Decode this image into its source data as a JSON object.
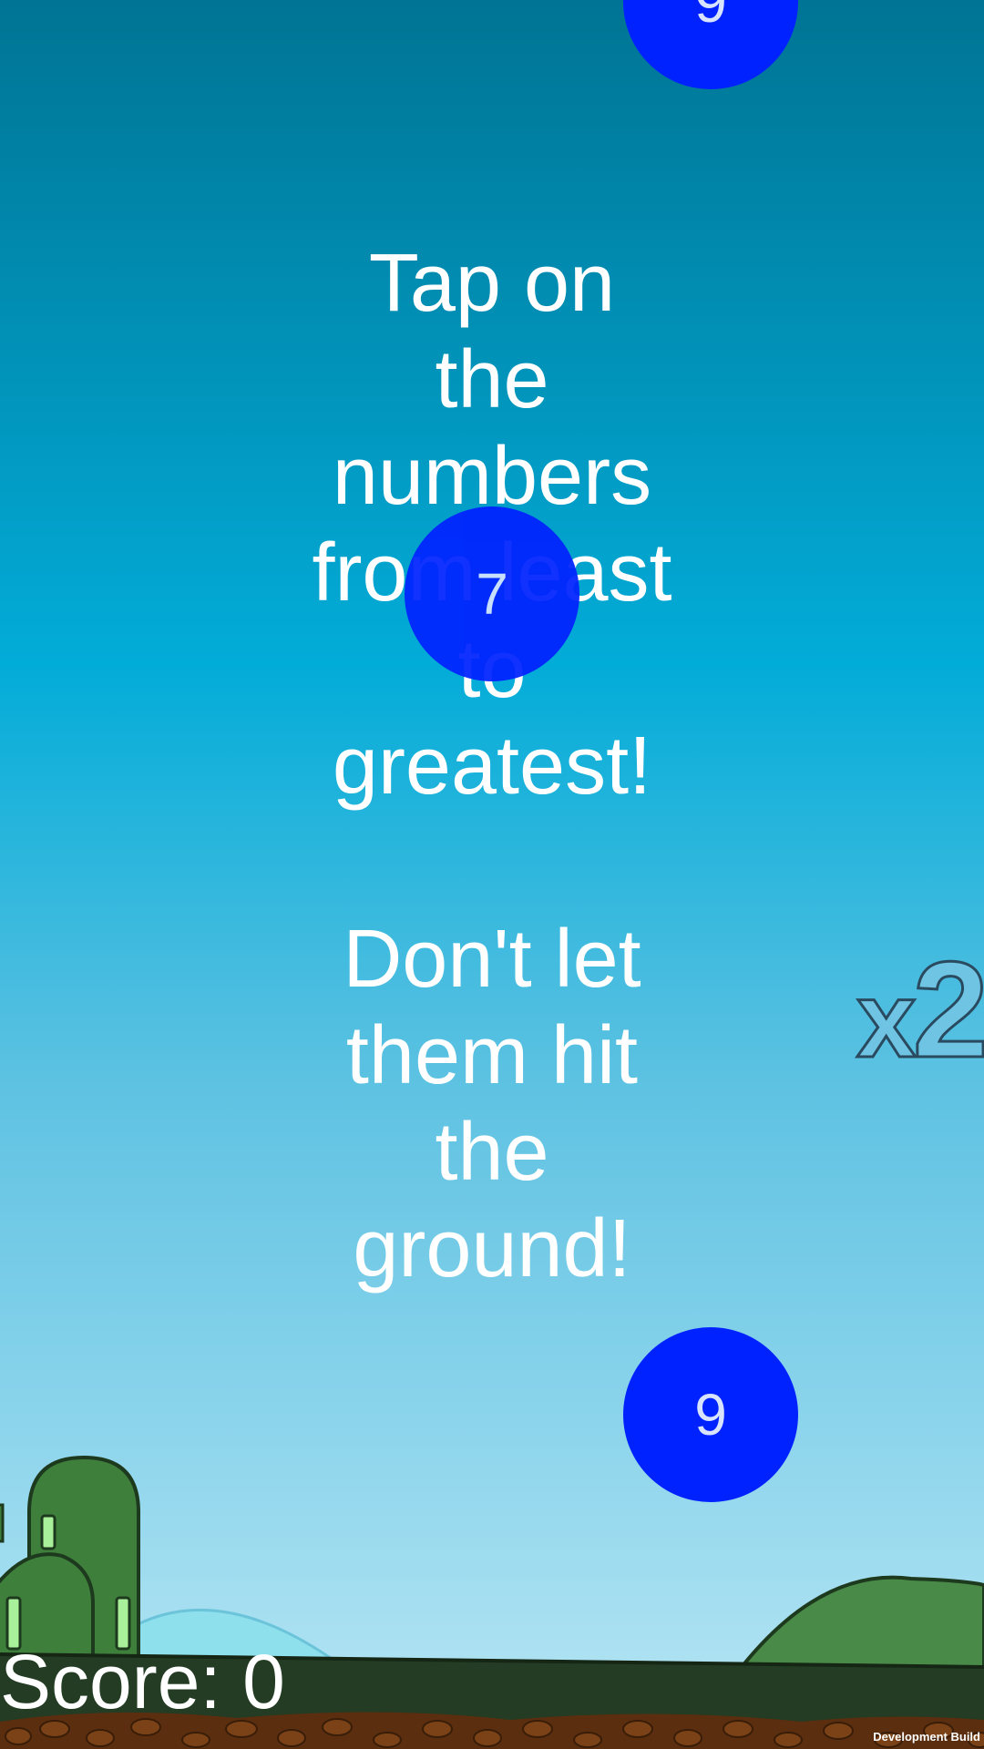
{
  "instructions": {
    "line_1": "Tap on the numbers from least to greatest!",
    "line_2": "Don't let them hit the ground!"
  },
  "balls": [
    {
      "value": "9",
      "color": "#0022ff"
    },
    {
      "value": "7",
      "color": "#0022ff"
    },
    {
      "value": "9",
      "color": "#0022ff"
    }
  ],
  "multiplier": {
    "x": "x",
    "value": "2"
  },
  "score": {
    "text": "Score: 0"
  },
  "footer": {
    "dev_build": "Development Build"
  },
  "colors": {
    "sky_top": "#007494",
    "sky_mid": "#02acd8",
    "sky_bottom": "#b8e4f2",
    "ball": "#0022ff",
    "ground": "#223b22",
    "hill": "#4a8a48"
  }
}
